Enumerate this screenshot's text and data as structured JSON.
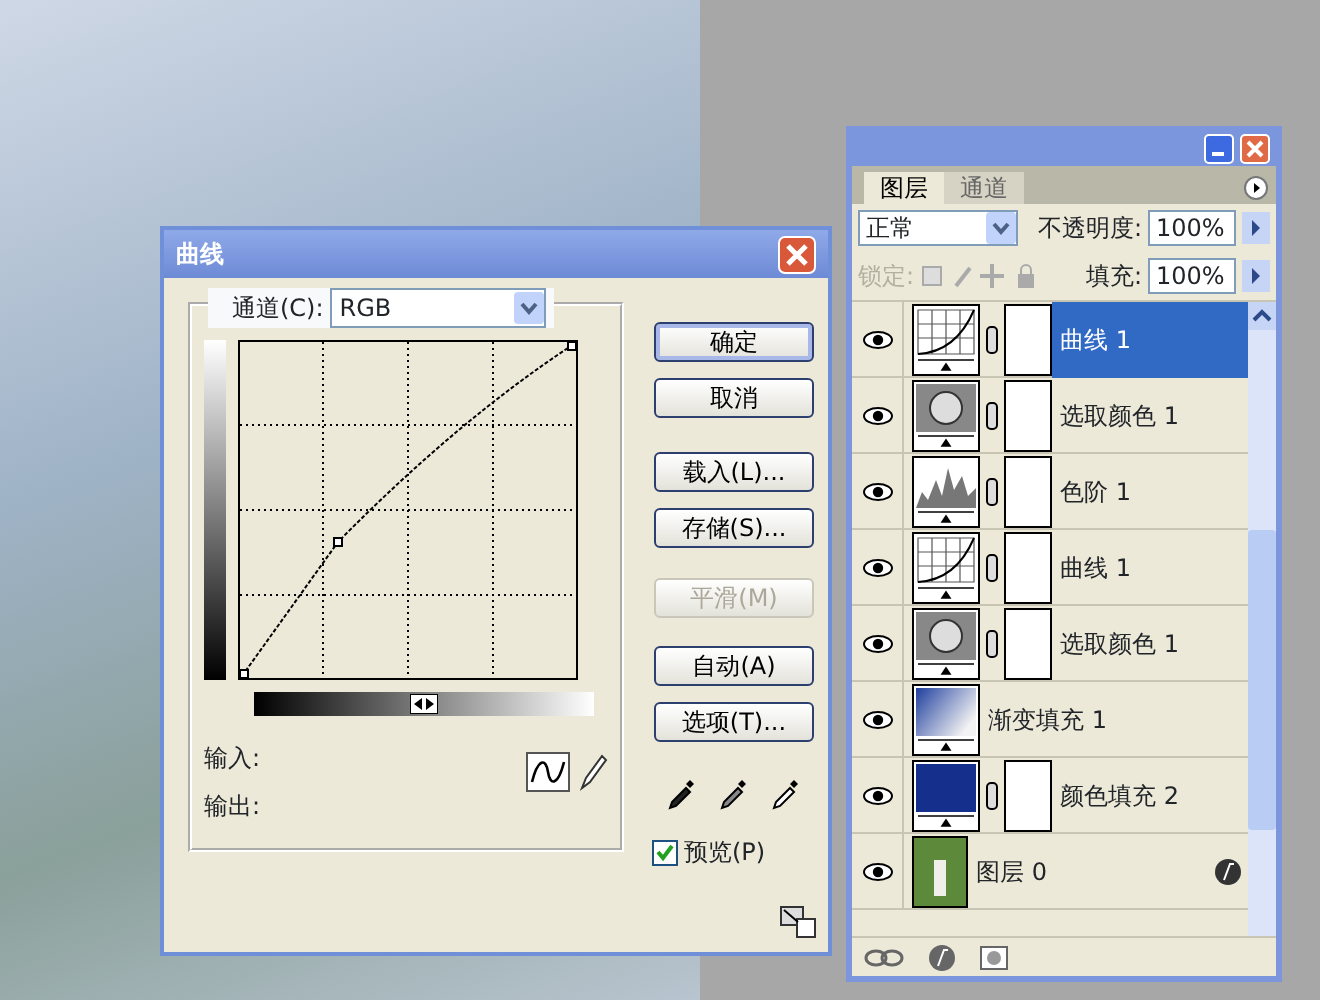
{
  "curves_dialog": {
    "title": "曲线",
    "channel_label": "通道(C):",
    "channel_value": "RGB",
    "buttons": [
      {
        "label": "确定",
        "default": true,
        "disabled": false
      },
      {
        "label": "取消",
        "default": false,
        "disabled": false
      },
      {
        "label": "载入(L)...",
        "default": false,
        "disabled": false
      },
      {
        "label": "存储(S)...",
        "default": false,
        "disabled": false
      },
      {
        "label": "平滑(M)",
        "default": false,
        "disabled": true
      },
      {
        "label": "自动(A)",
        "default": false,
        "disabled": false
      },
      {
        "label": "选项(T)...",
        "default": false,
        "disabled": false
      }
    ],
    "input_label": "输入:",
    "output_label": "输出:",
    "preview": {
      "label": "预览(P)",
      "checked": true
    }
  },
  "layers_panel": {
    "tabs": [
      {
        "label": "图层",
        "selected": true
      },
      {
        "label": "通道",
        "selected": false
      }
    ],
    "blend_mode": "正常",
    "opacity_label": "不透明度:",
    "opacity": "100%",
    "lock_label": "锁定:",
    "fill_label": "填充:",
    "fill": "100%",
    "layers": [
      {
        "name": "曲线 1",
        "kind": "curves",
        "visible": true,
        "selected": true,
        "mask": true,
        "effects": false
      },
      {
        "name": "选取颜色 1",
        "kind": "selective",
        "visible": true,
        "selected": false,
        "mask": true,
        "effects": false
      },
      {
        "name": "色阶 1",
        "kind": "levels",
        "visible": true,
        "selected": false,
        "mask": true,
        "effects": false
      },
      {
        "name": "曲线 1",
        "kind": "curves",
        "visible": true,
        "selected": false,
        "mask": true,
        "effects": false
      },
      {
        "name": "选取颜色 1",
        "kind": "selective",
        "visible": true,
        "selected": false,
        "mask": true,
        "effects": false
      },
      {
        "name": "渐变填充 1",
        "kind": "gradient",
        "visible": true,
        "selected": false,
        "mask": false,
        "effects": false
      },
      {
        "name": "颜色填充 2",
        "kind": "solid",
        "visible": true,
        "selected": false,
        "mask": true,
        "effects": false
      },
      {
        "name": "图层 0",
        "kind": "photo",
        "visible": true,
        "selected": false,
        "mask": false,
        "effects": true
      }
    ]
  }
}
